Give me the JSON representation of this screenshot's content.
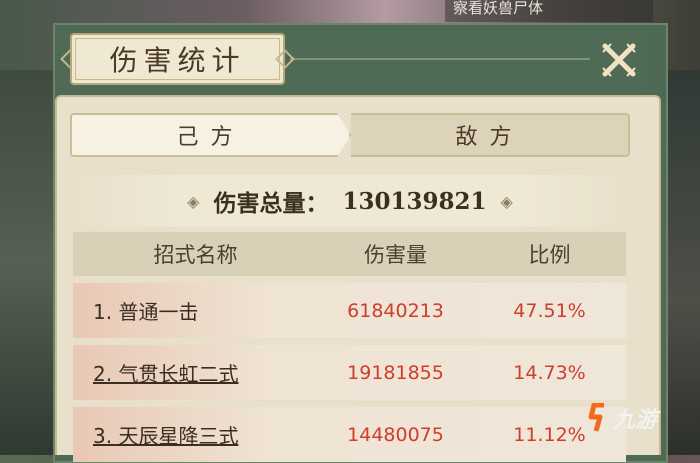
{
  "hint": "察看妖兽尸体",
  "title": "伤害统计",
  "tabs": [
    {
      "label": "己方",
      "active": true
    },
    {
      "label": "敌方",
      "active": false
    }
  ],
  "total": {
    "label": "伤害总量：",
    "value": "130139821"
  },
  "table": {
    "headers": [
      "招式名称",
      "伤害量",
      "比例"
    ],
    "rows": [
      {
        "name": "1. 普通一击",
        "damage": "61840213",
        "ratio": "47.51%"
      },
      {
        "name": "2. 气贯长虹二式",
        "damage": "19181855",
        "ratio": "14.73%"
      },
      {
        "name": "3. 天辰星降三式",
        "damage": "14480075",
        "ratio": "11.12%"
      }
    ]
  },
  "watermark": {
    "text": "九游"
  },
  "colors": {
    "accent_red": "#cf3d2c",
    "panel_green": "#4f6a54"
  }
}
